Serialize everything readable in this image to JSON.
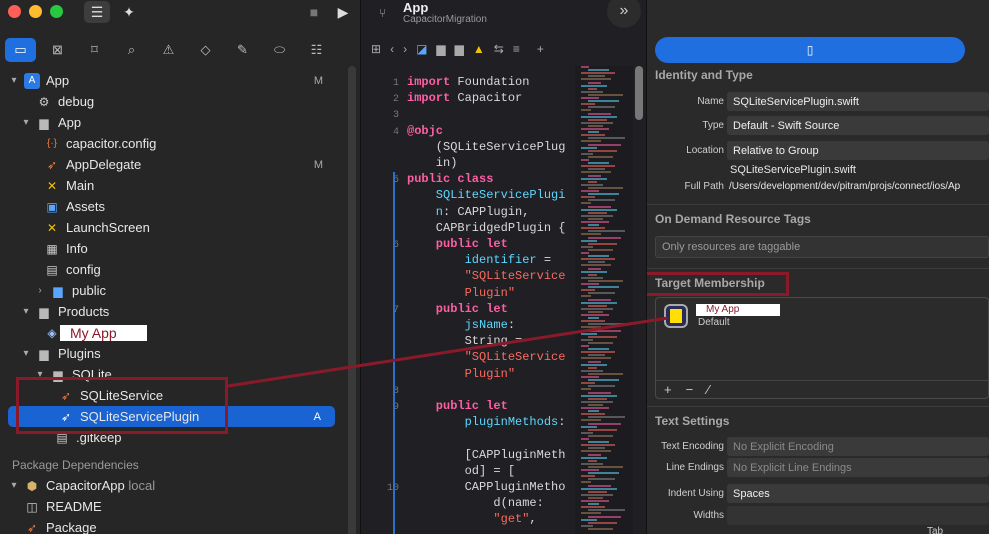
{
  "toolbar": {
    "editor_title": "App",
    "editor_subtitle": "CapacitorMigration"
  },
  "navigator": {
    "rows": [
      {
        "label": "App",
        "badge": "M"
      },
      {
        "label": "debug"
      },
      {
        "label": "App"
      },
      {
        "label": "capacitor.config"
      },
      {
        "label": "AppDelegate",
        "badge": "M"
      },
      {
        "label": "Main"
      },
      {
        "label": "Assets"
      },
      {
        "label": "LaunchScreen"
      },
      {
        "label": "Info"
      },
      {
        "label": "config"
      },
      {
        "label": "public"
      },
      {
        "label": "Products"
      },
      {
        "label": "My App"
      },
      {
        "label": "Plugins"
      },
      {
        "label": "SQLite"
      },
      {
        "label": "SQLiteService"
      },
      {
        "label": "SQLiteServicePlugin",
        "badge": "A"
      },
      {
        "label": ".gitkeep"
      }
    ],
    "package_section": "Package Dependencies",
    "pkg_rows": [
      {
        "label": "CapacitorApp",
        "suffix": "local"
      },
      {
        "label": "README"
      },
      {
        "label": "Package"
      }
    ]
  },
  "code": {
    "lines": [
      {
        "n": "1",
        "t": [
          [
            "kw",
            "import"
          ],
          [
            "",
            "Foundation"
          ]
        ]
      },
      {
        "n": "2",
        "t": [
          [
            "kw",
            "import"
          ],
          [
            "",
            "Capacitor"
          ]
        ]
      },
      {
        "n": "3",
        "t": []
      },
      {
        "n": "4",
        "t": [
          [
            "kw",
            "@objc"
          ]
        ]
      },
      {
        "n": "",
        "t": [
          [
            "",
            "    (SQLiteServicePlug"
          ]
        ]
      },
      {
        "n": "",
        "t": [
          [
            "",
            "    in)"
          ]
        ]
      },
      {
        "n": "5",
        "t": [
          [
            "kw",
            "public class"
          ]
        ]
      },
      {
        "n": "",
        "t": [
          [
            "id",
            "    SQLiteServicePlugi"
          ]
        ]
      },
      {
        "n": "",
        "t": [
          [
            "id",
            "    n"
          ],
          [
            "",
            ": CAPPlugin,"
          ]
        ]
      },
      {
        "n": "",
        "t": [
          [
            "",
            "    CAPBridgedPlugin {"
          ]
        ]
      },
      {
        "n": "6",
        "t": [
          [
            "kw",
            "    public let"
          ]
        ]
      },
      {
        "n": "",
        "t": [
          [
            "id",
            "        identifier"
          ],
          [
            "",
            " ="
          ]
        ]
      },
      {
        "n": "",
        "t": [
          [
            "str",
            "        \"SQLiteService"
          ]
        ]
      },
      {
        "n": "",
        "t": [
          [
            "str",
            "        Plugin\""
          ]
        ]
      },
      {
        "n": "7",
        "t": [
          [
            "kw",
            "    public let"
          ]
        ]
      },
      {
        "n": "",
        "t": [
          [
            "id",
            "        jsName"
          ],
          [
            "",
            ":"
          ]
        ]
      },
      {
        "n": "",
        "t": [
          [
            "",
            "        String ="
          ]
        ]
      },
      {
        "n": "",
        "t": [
          [
            "str",
            "        \"SQLiteService"
          ]
        ]
      },
      {
        "n": "",
        "t": [
          [
            "str",
            "        Plugin\""
          ]
        ]
      },
      {
        "n": "8",
        "t": []
      },
      {
        "n": "9",
        "t": [
          [
            "kw",
            "    public let"
          ]
        ]
      },
      {
        "n": "",
        "t": [
          [
            "id",
            "        pluginMethods"
          ],
          [
            "",
            ":"
          ]
        ]
      },
      {
        "n": "",
        "t": []
      },
      {
        "n": "",
        "t": [
          [
            "",
            "        [CAPPluginMeth"
          ]
        ]
      },
      {
        "n": "",
        "t": [
          [
            "",
            "        od] = ["
          ]
        ]
      },
      {
        "n": "10",
        "t": [
          [
            "",
            "        CAPPluginMetho"
          ]
        ]
      },
      {
        "n": "",
        "t": [
          [
            "",
            "            d(name:"
          ]
        ]
      },
      {
        "n": "",
        "t": [
          [
            "str",
            "            \"get\""
          ],
          [
            "",
            ","
          ]
        ]
      }
    ]
  },
  "inspector": {
    "identity_header": "Identity and Type",
    "name_label": "Name",
    "name_value": "SQLiteServicePlugin.swift",
    "type_label": "Type",
    "type_value": "Default - Swift Source",
    "location_label": "Location",
    "location_value": "Relative to Group",
    "location_file": "SQLiteServicePlugin.swift",
    "fullpath_label": "Full Path",
    "fullpath_value": "/Users/development/dev/pitram/projs/connect/ios/Ap",
    "odr_header": "On Demand Resource Tags",
    "odr_placeholder": "Only resources are taggable",
    "target_header": "Target Membership",
    "target_name": "My App",
    "target_sub": "Default",
    "text_header": "Text Settings",
    "enc_label": "Text Encoding",
    "enc_value": "No Explicit Encoding",
    "le_label": "Line Endings",
    "le_value": "No Explicit Line Endings",
    "indent_label": "Indent Using",
    "indent_value": "Spaces",
    "widths_label": "Widths",
    "tab_label": "Tab",
    "add": "+",
    "remove": "−",
    "edit": "⁄"
  }
}
